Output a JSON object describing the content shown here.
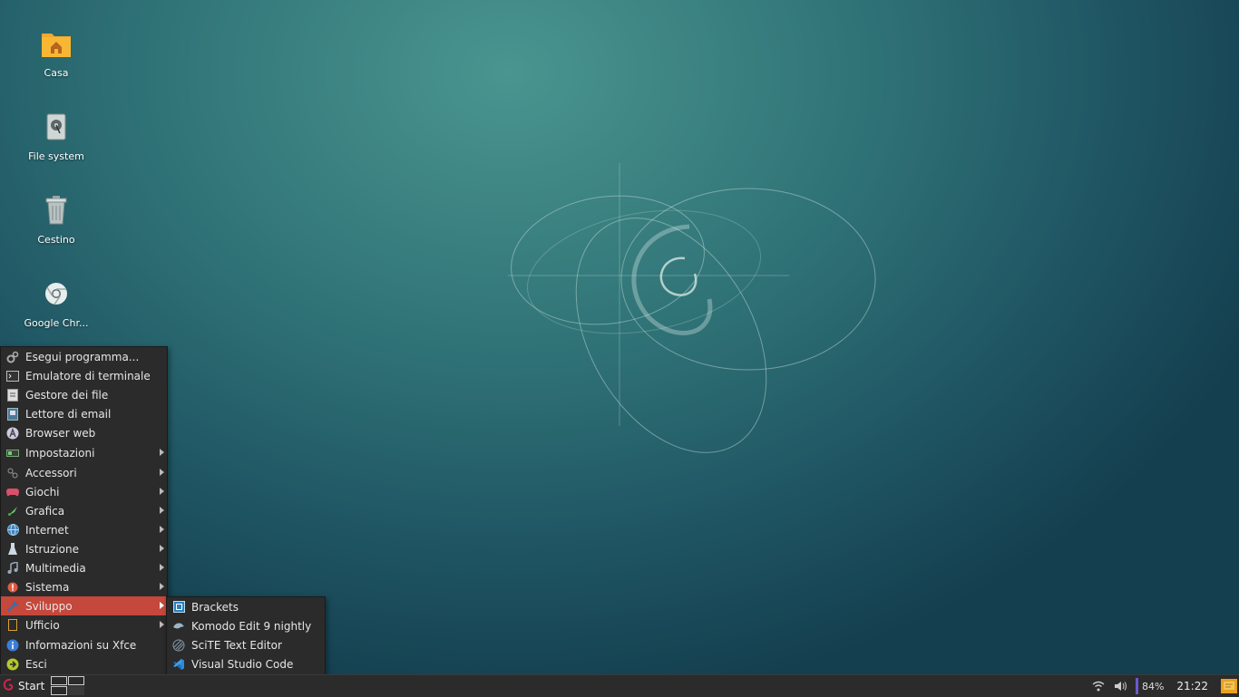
{
  "desktop": {
    "icons": [
      {
        "label": "Casa",
        "icon": "home-folder-icon"
      },
      {
        "label": "File system",
        "icon": "drive-icon"
      },
      {
        "label": "Cestino",
        "icon": "trash-icon"
      },
      {
        "label": "Google Chr...",
        "icon": "chrome-icon"
      }
    ]
  },
  "menu": {
    "items": [
      {
        "label": "Esegui programma...",
        "icon": "gears-icon",
        "submenu": false
      },
      {
        "label": "Emulatore di terminale",
        "icon": "terminal-icon",
        "submenu": false
      },
      {
        "label": "Gestore dei file",
        "icon": "file-manager-icon",
        "submenu": false
      },
      {
        "label": "Lettore di email",
        "icon": "email-icon",
        "submenu": false
      },
      {
        "label": "Browser web",
        "icon": "web-browser-icon",
        "submenu": false
      },
      {
        "label": "Impostazioni",
        "icon": "settings-icon",
        "submenu": true
      },
      {
        "label": "Accessori",
        "icon": "accessories-icon",
        "submenu": true
      },
      {
        "label": "Giochi",
        "icon": "gamepad-icon",
        "submenu": true
      },
      {
        "label": "Grafica",
        "icon": "graphics-icon",
        "submenu": true
      },
      {
        "label": "Internet",
        "icon": "globe-icon",
        "submenu": true
      },
      {
        "label": "Istruzione",
        "icon": "education-icon",
        "submenu": true
      },
      {
        "label": "Multimedia",
        "icon": "music-icon",
        "submenu": true
      },
      {
        "label": "Sistema",
        "icon": "system-icon",
        "submenu": true
      },
      {
        "label": "Sviluppo",
        "icon": "wrench-icon",
        "submenu": true,
        "active": true
      },
      {
        "label": "Ufficio",
        "icon": "office-icon",
        "submenu": true
      },
      {
        "label": "Informazioni su Xfce",
        "icon": "info-icon",
        "submenu": false
      },
      {
        "label": "Esci",
        "icon": "logout-icon",
        "submenu": false
      }
    ]
  },
  "submenu": {
    "items": [
      {
        "label": "Brackets",
        "icon": "brackets-icon"
      },
      {
        "label": "Komodo Edit 9 nightly",
        "icon": "komodo-icon"
      },
      {
        "label": "SciTE Text Editor",
        "icon": "scite-icon"
      },
      {
        "label": "Visual Studio Code",
        "icon": "vscode-icon"
      }
    ]
  },
  "taskbar": {
    "start_label": "Start",
    "battery": "84%",
    "clock": "21:22"
  },
  "colors": {
    "active_item": "#c6473b",
    "panel_bg": "#2b2b2b",
    "desktop_bg": "#2f7276"
  }
}
